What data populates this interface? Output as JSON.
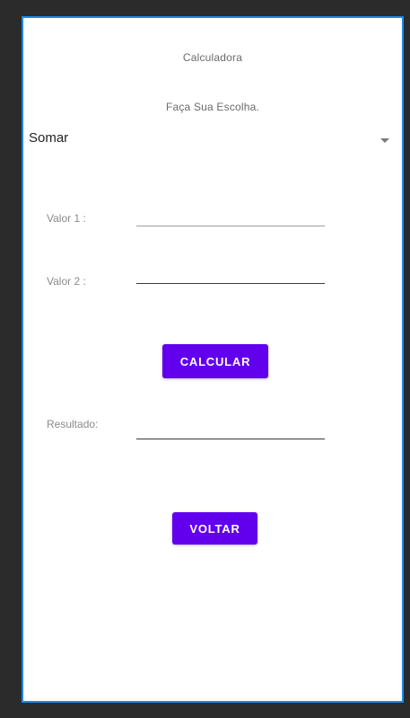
{
  "header": {
    "title": "Calculadora",
    "subtitle": "Faça Sua Escolha."
  },
  "operation_select": {
    "selected": "Somar",
    "icon": "dropdown-arrow-icon"
  },
  "form": {
    "value1_label": "Valor 1 :",
    "value1": "",
    "value2_label": "Valor 2 :",
    "value2": "",
    "result_label": "Resultado:",
    "result": ""
  },
  "buttons": {
    "calculate_label": "CALCULAR",
    "back_label": "VOLTAR"
  },
  "colors": {
    "accent": "#6200ee",
    "screen_border": "#1e88e5",
    "frame": "#2b2b2b"
  }
}
